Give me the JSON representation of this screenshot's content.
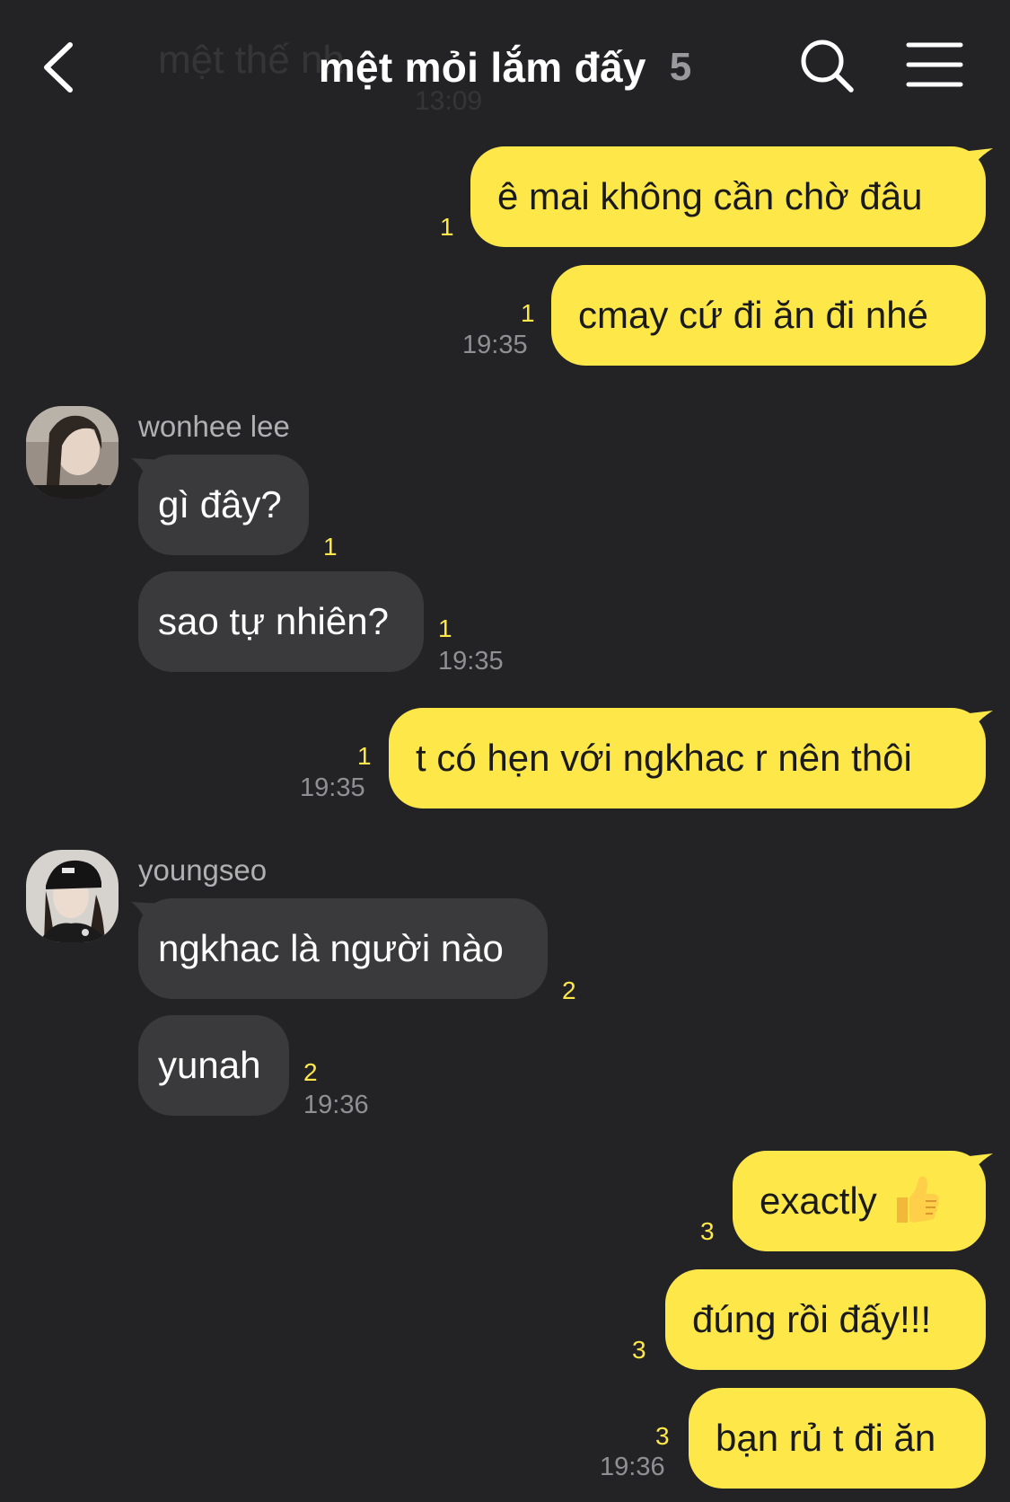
{
  "header": {
    "title": "mệt mỏi lắm đấy",
    "member_count": "5",
    "ghost_preview": "mệt thế nh",
    "ghost_time": "13:09"
  },
  "icons": {
    "back": "back-chevron-icon",
    "search": "search-icon",
    "menu": "menu-icon"
  },
  "colors": {
    "background": "#232325",
    "my_bubble": "#fee849",
    "their_bubble": "#3a3a3c",
    "unread": "#fee849"
  },
  "messages": [
    {
      "from": "me",
      "text": "ê mai không cần chờ đâu",
      "unread": "1"
    },
    {
      "from": "me",
      "text": "cmay cứ đi ăn đi nhé",
      "unread": "1",
      "time": "19:35"
    },
    {
      "from": "wonhee lee",
      "text": "gì đây?",
      "unread": "1"
    },
    {
      "from": "wonhee lee",
      "text": "sao tự nhiên?",
      "unread": "1",
      "time": "19:35"
    },
    {
      "from": "me",
      "text": "t có hẹn với ngkhac r nên thôi",
      "unread": "1",
      "time": "19:35"
    },
    {
      "from": "youngseo",
      "text": "ngkhac là người nào",
      "unread": "2"
    },
    {
      "from": "youngseo",
      "text": "yunah",
      "unread": "2",
      "time": "19:36"
    },
    {
      "from": "me",
      "text": "exactly",
      "emoji": "thumbs-up-emoji",
      "unread": "3"
    },
    {
      "from": "me",
      "text": "đúng rồi đấy!!!",
      "unread": "3"
    },
    {
      "from": "me",
      "text": "bạn rủ t đi ăn",
      "unread": "3",
      "time": "19:36"
    }
  ],
  "senders": {
    "wonhee": "wonhee lee",
    "youngseo": "youngseo"
  }
}
